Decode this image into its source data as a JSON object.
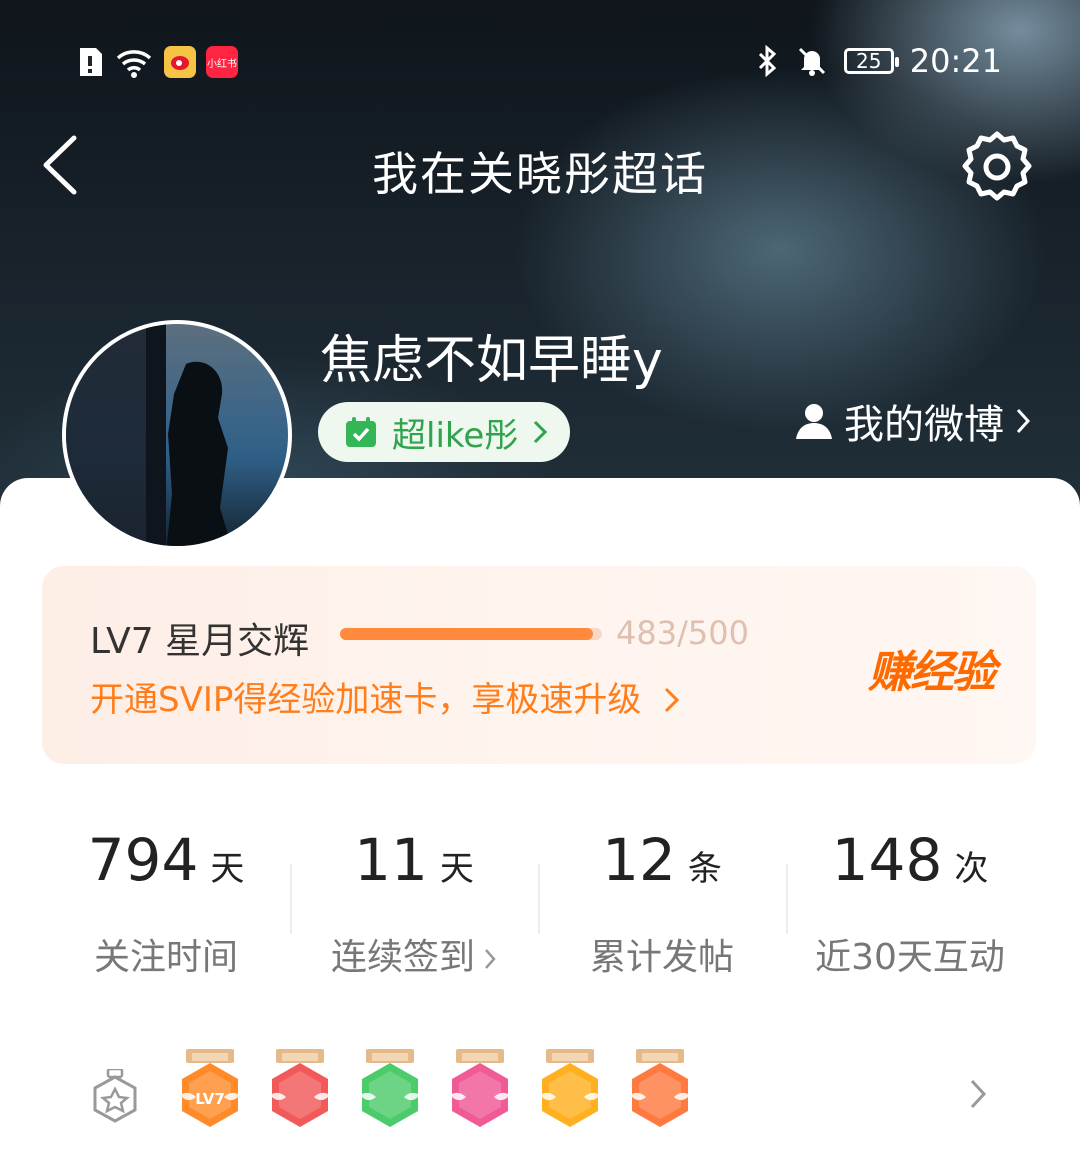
{
  "status_bar": {
    "time": "20:21",
    "battery": "25",
    "app_label": "小红书"
  },
  "nav": {
    "title": "我在关晓彤超话"
  },
  "profile": {
    "username": "焦虑不如早睡y",
    "badge_label": "超like彤",
    "weibo_link": "我的微博"
  },
  "level": {
    "name": "LV7 星月交辉",
    "progress_current": 483,
    "progress_max": 500,
    "progress_text": "483/500",
    "svip_text": "开通SVIP得经验加速卡，享极速升级",
    "earn_label": "赚经验"
  },
  "stats": [
    {
      "value": "794",
      "unit": "天",
      "label": "关注时间"
    },
    {
      "value": "11",
      "unit": "天",
      "label": "连续签到"
    },
    {
      "value": "12",
      "unit": "条",
      "label": "累计发帖"
    },
    {
      "value": "148",
      "unit": "次",
      "label": "近30天互动"
    }
  ],
  "medals": {
    "items": [
      {
        "name": "lv7-medal",
        "color": "#ff8a2a",
        "text": "LV7"
      },
      {
        "name": "trophy-medal",
        "color": "#f25a5a",
        "text": ""
      },
      {
        "name": "hand-medal",
        "color": "#4ccb6a",
        "text": ""
      },
      {
        "name": "graduation-medal",
        "color": "#f05a95",
        "text": ""
      },
      {
        "name": "emoji-medal",
        "color": "#ffb020",
        "text": ""
      },
      {
        "name": "rock-hand-medal",
        "color": "#ff7a40",
        "text": ""
      }
    ]
  },
  "colors": {
    "accent_orange": "#ff7d1a",
    "badge_green": "#2fa34d"
  }
}
